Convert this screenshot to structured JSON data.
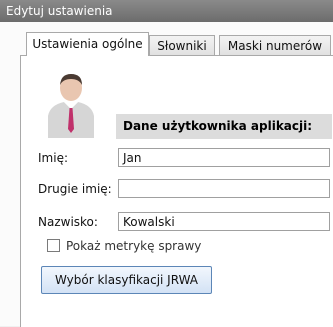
{
  "window": {
    "title": "Edytuj ustawienia"
  },
  "tabs": [
    {
      "label": "Ustawienia ogólne",
      "active": true
    },
    {
      "label": "Słowniki",
      "active": false
    },
    {
      "label": "Maski numerów",
      "active": false
    }
  ],
  "section": {
    "title": "Dane użytkownika aplikacji:"
  },
  "form": {
    "first_name": {
      "label": "Imię:",
      "value": "Jan"
    },
    "middle_name": {
      "label": "Drugie imię:",
      "value": ""
    },
    "last_name": {
      "label": "Nazwisko:",
      "value": "Kowalski"
    },
    "show_metric": {
      "label": "Pokaż metrykę sprawy",
      "checked": false
    }
  },
  "button": {
    "label": "Wybór klasyfikacji JRWA"
  },
  "icons": {
    "avatar": "user-avatar-icon"
  }
}
